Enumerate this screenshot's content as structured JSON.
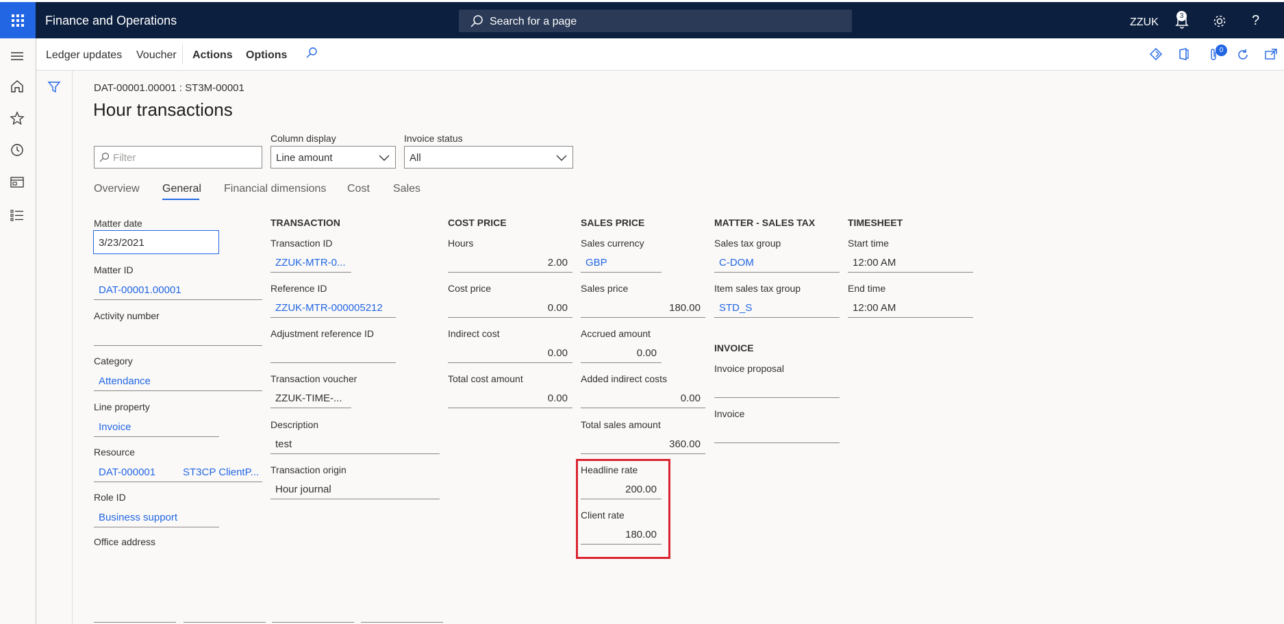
{
  "app": {
    "title": "Finance and Operations",
    "search_placeholder": "Search for a page",
    "company": "ZZUK",
    "notification_count": "3",
    "help": "?"
  },
  "icons": [
    "waffle-icon",
    "search-icon",
    "bell-icon",
    "gear-icon",
    "help-icon",
    "hamburger-icon",
    "home-icon",
    "star-icon",
    "clock-icon",
    "workspace-icon",
    "list-icon",
    "filter-icon",
    "diamond-icon",
    "office-icon",
    "attachment-icon",
    "refresh-icon",
    "open-new-window-icon",
    "chevron-down-icon"
  ],
  "actionpane": {
    "items": [
      "Ledger updates",
      "Voucher",
      "Actions",
      "Options"
    ],
    "attachment_count": "0"
  },
  "header": {
    "caption": "DAT-00001.00001 : ST3M-00001",
    "title": "Hour transactions"
  },
  "filters": {
    "filter_placeholder": "Filter",
    "column_display_label": "Column display",
    "column_display_value": "Line amount",
    "invoice_status_label": "Invoice status",
    "invoice_status_value": "All"
  },
  "tabs": [
    "Overview",
    "General",
    "Financial dimensions",
    "Cost",
    "Sales"
  ],
  "active_tab": "General",
  "matter": {
    "matter_date_label": "Matter date",
    "matter_date": "3/23/2021",
    "matter_id_label": "Matter ID",
    "matter_id": "DAT-00001.00001",
    "activity_number_label": "Activity number",
    "activity_number": "",
    "category_label": "Category",
    "category": "Attendance",
    "line_property_label": "Line property",
    "line_property": "Invoice",
    "resource_label": "Resource",
    "resource_id": "DAT-000001",
    "resource_name": "ST3CP ClientP...",
    "role_id_label": "Role ID",
    "role_id": "Business support",
    "office_address_label": "Office address"
  },
  "transaction": {
    "heading": "TRANSACTION",
    "transaction_id_label": "Transaction ID",
    "transaction_id": "ZZUK-MTR-0...",
    "reference_id_label": "Reference ID",
    "reference_id": "ZZUK-MTR-000005212",
    "adjustment_ref_label": "Adjustment reference ID",
    "adjustment_ref": "",
    "voucher_label": "Transaction voucher",
    "voucher": "ZZUK-TIME-...",
    "description_label": "Description",
    "description": "test",
    "origin_label": "Transaction origin",
    "origin": "Hour journal"
  },
  "cost_price": {
    "heading": "COST PRICE",
    "hours_label": "Hours",
    "hours": "2.00",
    "cost_price_label": "Cost price",
    "cost_price": "0.00",
    "indirect_cost_label": "Indirect cost",
    "indirect_cost": "0.00",
    "total_cost_label": "Total cost amount",
    "total_cost": "0.00"
  },
  "sales_price": {
    "heading": "SALES PRICE",
    "currency_label": "Sales currency",
    "currency": "GBP",
    "sales_price_label": "Sales price",
    "sales_price": "180.00",
    "accrued_label": "Accrued amount",
    "accrued": "0.00",
    "added_indirect_label": "Added indirect costs",
    "added_indirect": "0.00",
    "total_sales_label": "Total sales amount",
    "total_sales": "360.00",
    "headline_rate_label": "Headline rate",
    "headline_rate": "200.00",
    "client_rate_label": "Client rate",
    "client_rate": "180.00"
  },
  "matter_tax": {
    "heading": "MATTER - SALES TAX",
    "tax_group_label": "Sales tax group",
    "tax_group": "C-DOM",
    "item_tax_group_label": "Item sales tax group",
    "item_tax_group": "STD_S"
  },
  "invoice": {
    "heading": "INVOICE",
    "proposal_label": "Invoice proposal",
    "proposal": "",
    "invoice_label": "Invoice",
    "invoice": ""
  },
  "timesheet": {
    "heading": "TIMESHEET",
    "start_label": "Start time",
    "start": "12:00 AM",
    "end_label": "End time",
    "end": "12:00 AM"
  },
  "colors": {
    "nav": "#0c1f3f",
    "accent": "#2266e3",
    "highlight": "#d9232f"
  }
}
